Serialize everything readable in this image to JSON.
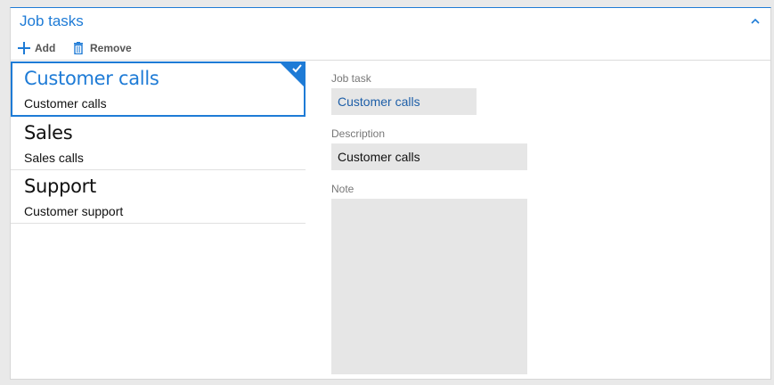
{
  "section": {
    "title": "Job tasks",
    "collapse_icon": "chevron-up-icon"
  },
  "toolbar": {
    "add_label": "Add",
    "remove_label": "Remove"
  },
  "list": {
    "items": [
      {
        "title": "Customer calls",
        "subtitle": "Customer calls",
        "selected": true
      },
      {
        "title": "Sales",
        "subtitle": "Sales calls",
        "selected": false
      },
      {
        "title": "Support",
        "subtitle": "Customer support",
        "selected": false
      }
    ]
  },
  "form": {
    "job_task_label": "Job task",
    "job_task_value": "Customer calls",
    "description_label": "Description",
    "description_value": "Customer calls",
    "note_label": "Note",
    "note_value": ""
  },
  "colors": {
    "accent": "#1e7bd6",
    "field_bg": "#e6e6e6"
  }
}
